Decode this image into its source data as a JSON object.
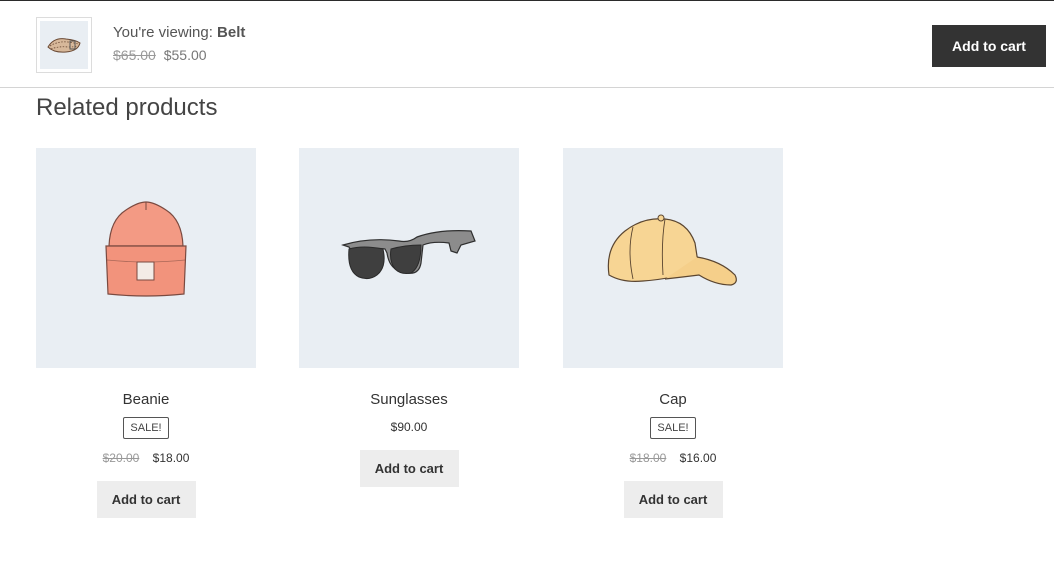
{
  "sticky": {
    "viewing_prefix": "You're viewing:",
    "product_name": "Belt",
    "old_price": "$65.00",
    "price": "$55.00",
    "add_to_cart": "Add to cart"
  },
  "related": {
    "title": "Related products",
    "products": [
      {
        "name": "Beanie",
        "badge": "SALE!",
        "old_price": "$20.00",
        "price": "$18.00",
        "button": "Add to cart"
      },
      {
        "name": "Sunglasses",
        "badge": "",
        "old_price": "",
        "price": "$90.00",
        "button": "Add to cart"
      },
      {
        "name": "Cap",
        "badge": "SALE!",
        "old_price": "$18.00",
        "price": "$16.00",
        "button": "Add to cart"
      }
    ]
  },
  "colors": {
    "dark_button": "#333333",
    "light_button": "#ededed",
    "image_bg": "#e9eef3"
  },
  "icons": [
    "belt-icon",
    "beanie-icon",
    "sunglasses-icon",
    "cap-icon"
  ]
}
